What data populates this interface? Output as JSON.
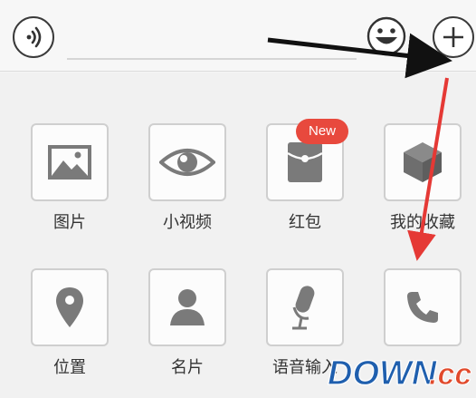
{
  "toolbar": {
    "voice_icon": "voice-icon",
    "emoji_icon": "emoji-icon",
    "plus_icon": "plus-icon"
  },
  "grid": {
    "items": [
      {
        "label": "图片",
        "icon": "image-icon"
      },
      {
        "label": "小视频",
        "icon": "eye-icon"
      },
      {
        "label": "红包",
        "icon": "red-packet-icon"
      },
      {
        "label": "我的收藏",
        "icon": "box-icon"
      },
      {
        "label": "位置",
        "icon": "location-pin-icon"
      },
      {
        "label": "名片",
        "icon": "person-icon"
      },
      {
        "label": "语音输入",
        "icon": "microphone-icon"
      },
      {
        "label": "",
        "icon": "phone-icon"
      }
    ],
    "badge": "New"
  },
  "watermark": {
    "text_main": "DOWN",
    "text_suffix": ".cc"
  },
  "colors": {
    "badge": "#e8493d",
    "arrow_red": "#e53935",
    "arrow_black": "#111111",
    "watermark_blue": "#1f5fae",
    "watermark_red": "#e14a2c"
  }
}
